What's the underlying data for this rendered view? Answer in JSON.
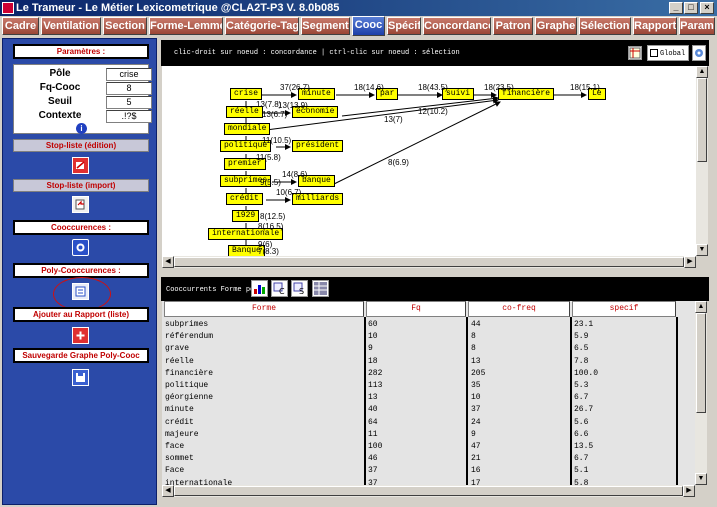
{
  "window": {
    "title": "Le Trameur - Le Métier Lexicometrique @CLA2T-P3 V. 8.0b085"
  },
  "tabs": [
    "Cadre",
    "Ventilation",
    "Section",
    "Forme-Lemme",
    "Catégorie-Tag",
    "Segment",
    "Cooc",
    "Spécif",
    "Concordance",
    "Patron",
    "Graphe",
    "Sélection",
    "Rapport",
    "Param"
  ],
  "active_tab": "Cooc",
  "left": {
    "params_header": "Paramètres :",
    "params": [
      {
        "label": "Pôle",
        "value": "crise"
      },
      {
        "label": "Fq-Cooc",
        "value": "8"
      },
      {
        "label": "Seuil",
        "value": "5"
      },
      {
        "label": "Contexte",
        "value": ".!?$"
      }
    ],
    "stoplist_edition": "Stop-liste (édition)",
    "stoplist_import": "Stop-liste (import)",
    "cooccurrences": "Cooccurences :",
    "poly_cooccurrences": "Poly-Cooccurences :",
    "add_report": "Ajouter au Rapport (liste)",
    "save_graph": "Sauvegarde Graphe Poly-Cooc",
    "info_icon_label": "i"
  },
  "graph_toolbar": {
    "hint": "clic-droit sur noeud : concordance | ctrl-clic sur noeud : sélection",
    "global_label": "Global"
  },
  "graph": {
    "nodes": [
      {
        "id": "crise",
        "label": "crise"
      },
      {
        "id": "minute",
        "label": "minute"
      },
      {
        "id": "par",
        "label": "par"
      },
      {
        "id": "suivi",
        "label": "suivi"
      },
      {
        "id": "financiere",
        "label": "financière"
      },
      {
        "id": "le",
        "label": "Le"
      },
      {
        "id": "reelle",
        "label": "réelle"
      },
      {
        "id": "economie",
        "label": "économie"
      },
      {
        "id": "mondiale",
        "label": "mondiale"
      },
      {
        "id": "politique",
        "label": "politique"
      },
      {
        "id": "president",
        "label": "président"
      },
      {
        "id": "premier",
        "label": "premier"
      },
      {
        "id": "subprimes",
        "label": "subprimes"
      },
      {
        "id": "banque",
        "label": "banque"
      },
      {
        "id": "credit",
        "label": "crédit"
      },
      {
        "id": "milliards",
        "label": "milliards"
      },
      {
        "id": "n1929",
        "label": "1929"
      },
      {
        "id": "internationale",
        "label": "internationale"
      },
      {
        "id": "banque2",
        "label": "Banque"
      }
    ],
    "edge_labels": [
      "37(26.7)",
      "18(14.6)",
      "18(43.5)",
      "18(23.5)",
      "18(15.1)",
      "13(7.8)",
      "13(13.9)",
      "13(6.7)",
      "12(10.2)",
      "13(7)",
      "11(10.5)",
      "11(5.8)",
      "14(8.6)",
      "9(5.5)",
      "10(6.7)",
      "8(6.9)",
      "8(12.5)",
      "8(16.5)",
      "9(6)",
      "7(8.3)"
    ]
  },
  "table_toolbar": {
    "title": "Cooccurrents Forme pôle"
  },
  "table": {
    "columns": [
      "Forme",
      "Fq",
      "co-freq",
      "specif"
    ],
    "rows": [
      [
        "subprimes",
        "60",
        "44",
        "23.1"
      ],
      [
        "référendum",
        "10",
        "8",
        "5.9"
      ],
      [
        "grave",
        "9",
        "8",
        "6.5"
      ],
      [
        "réelle",
        "18",
        "13",
        "7.8"
      ],
      [
        "financière",
        "282",
        "205",
        "100.0"
      ],
      [
        "politique",
        "113",
        "35",
        "5.3"
      ],
      [
        "géorgienne",
        "13",
        "10",
        "6.7"
      ],
      [
        "minute",
        "40",
        "37",
        "26.7"
      ],
      [
        "crédit",
        "64",
        "24",
        "5.6"
      ],
      [
        "majeure",
        "11",
        "9",
        "6.6"
      ],
      [
        "face",
        "100",
        "47",
        "13.5"
      ],
      [
        "sommet",
        "46",
        "21",
        "6.7"
      ],
      [
        "Face",
        "37",
        "16",
        "5.1"
      ],
      [
        "internationale",
        "37",
        "17",
        "5.8"
      ]
    ]
  }
}
